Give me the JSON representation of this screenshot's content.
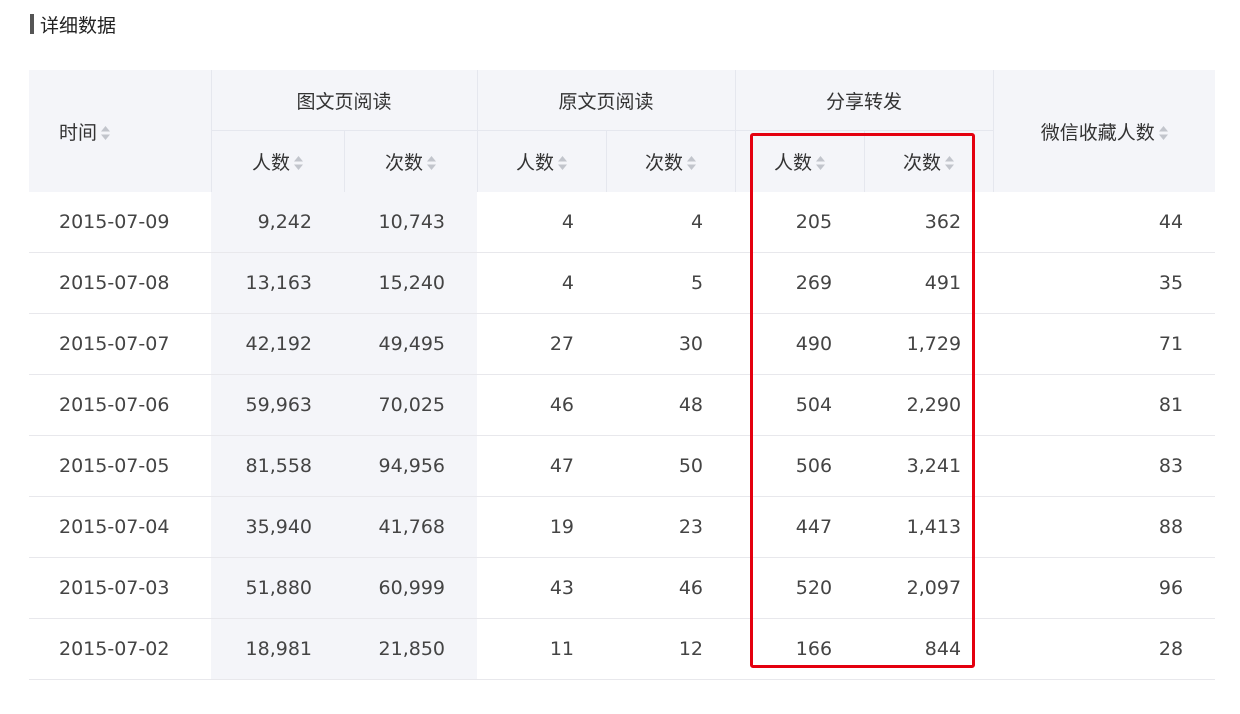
{
  "section": {
    "title": "详细数据"
  },
  "headers": {
    "time": "时间",
    "tuwen_read": "图文页阅读",
    "yuanwen_read": "原文页阅读",
    "share": "分享转发",
    "favorites": "微信收藏人数",
    "people": "人数",
    "times": "次数"
  },
  "rows": [
    {
      "date": "2015-07-09",
      "tw_people": "9,242",
      "tw_times": "10,743",
      "yw_people": "4",
      "yw_times": "4",
      "sh_people": "205",
      "sh_times": "362",
      "fav": "44"
    },
    {
      "date": "2015-07-08",
      "tw_people": "13,163",
      "tw_times": "15,240",
      "yw_people": "4",
      "yw_times": "5",
      "sh_people": "269",
      "sh_times": "491",
      "fav": "35"
    },
    {
      "date": "2015-07-07",
      "tw_people": "42,192",
      "tw_times": "49,495",
      "yw_people": "27",
      "yw_times": "30",
      "sh_people": "490",
      "sh_times": "1,729",
      "fav": "71"
    },
    {
      "date": "2015-07-06",
      "tw_people": "59,963",
      "tw_times": "70,025",
      "yw_people": "46",
      "yw_times": "48",
      "sh_people": "504",
      "sh_times": "2,290",
      "fav": "81"
    },
    {
      "date": "2015-07-05",
      "tw_people": "81,558",
      "tw_times": "94,956",
      "yw_people": "47",
      "yw_times": "50",
      "sh_people": "506",
      "sh_times": "3,241",
      "fav": "83"
    },
    {
      "date": "2015-07-04",
      "tw_people": "35,940",
      "tw_times": "41,768",
      "yw_people": "19",
      "yw_times": "23",
      "sh_people": "447",
      "sh_times": "1,413",
      "fav": "88"
    },
    {
      "date": "2015-07-03",
      "tw_people": "51,880",
      "tw_times": "60,999",
      "yw_people": "43",
      "yw_times": "46",
      "sh_people": "520",
      "sh_times": "2,097",
      "fav": "96"
    },
    {
      "date": "2015-07-02",
      "tw_people": "18,981",
      "tw_times": "21,850",
      "yw_people": "11",
      "yw_times": "12",
      "sh_people": "166",
      "sh_times": "844",
      "fav": "28"
    }
  ],
  "colors": {
    "header_bg": "#f4f5f9",
    "highlight": "#e4000f"
  },
  "icons": {
    "sort": "sort-arrows-icon"
  }
}
